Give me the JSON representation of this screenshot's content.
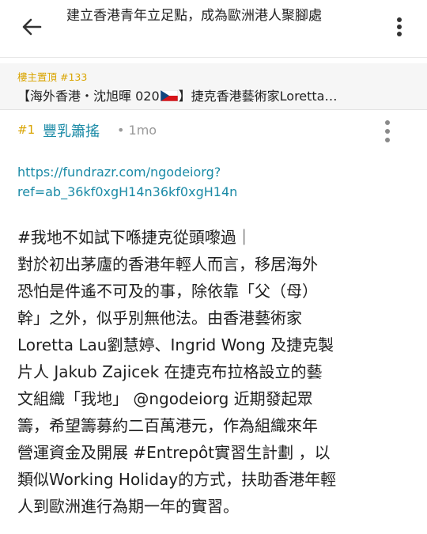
{
  "header": {
    "title": "建立香港青年立足點，成為歐洲港人聚腳處",
    "back_icon": "arrow-left-icon",
    "menu_icon": "more-vertical-icon"
  },
  "pinned": {
    "label": "樓主置頂 #133",
    "text_before_flag": "【海外香港・沈旭暉 020",
    "flag_icon": "czech-flag-icon",
    "text_after_flag": "】捷克香港藝術家Loretta…"
  },
  "post": {
    "number": "#1",
    "author": "豐乳簫搖",
    "time": "• 1mo",
    "menu_icon": "more-vertical-icon",
    "link_line1": "https://fundrazr.com/ngodeiorg?",
    "link_line2": "ref=ab_36kf0xgH14n36kf0xgH14n",
    "body_lines": [
      "#我地不如試下喺捷克從頭嚟過｜",
      "對於初出茅廬的香港年輕人而言，移居海外",
      "恐怕是件遙不可及的事，除依靠「父（母）",
      "幹」之外，似乎別無他法。由香港藝術家",
      "Loretta Lau劉慧婷、Ingrid Wong 及捷克製",
      "片人 Jakub Zajicek 在捷克布拉格設立的藝",
      "文組織「我地」 @ngodeiorg 近期發起眾",
      "籌，希望籌募約二百萬港元，作為組織來年",
      "營運資金及開展 #Entrepôt實習生計劃 ，以",
      "類似Working Holiday的方式，扶助香港年輕",
      "人到歐洲進行為期一年的實習。"
    ]
  },
  "colors": {
    "accent_gold": "#d9a400",
    "link_teal": "#1a8aa6",
    "muted": "#9a9a9a"
  }
}
